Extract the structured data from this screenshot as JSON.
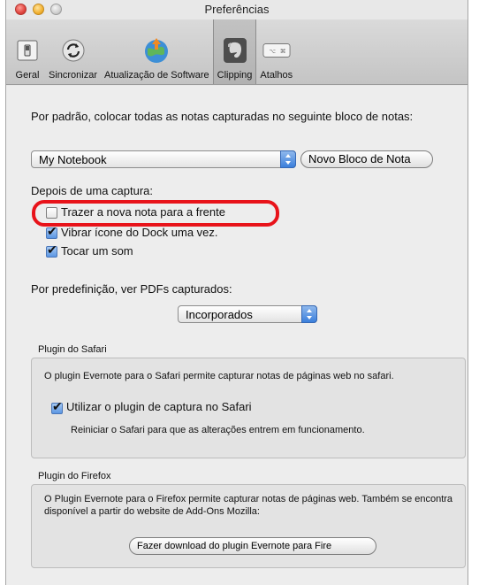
{
  "window": {
    "title": "Preferências"
  },
  "toolbar": {
    "items": [
      {
        "label": "Geral",
        "icon": "general-switch-icon"
      },
      {
        "label": "Sincronizar",
        "icon": "sync-icon"
      },
      {
        "label": "Atualização de Software",
        "icon": "software-update-globe-icon"
      },
      {
        "label": "Clipping",
        "icon": "evernote-elephant-icon",
        "selected": true
      },
      {
        "label": "Atalhos",
        "icon": "keyboard-shortcut-icon"
      }
    ]
  },
  "notebook": {
    "prompt": "Por padrão, colocar todas as notas capturadas no seguinte bloco de notas:",
    "selected": "My Notebook",
    "new_button": "Novo Bloco de Nota"
  },
  "after_capture": {
    "heading": "Depois de uma captura:",
    "options": [
      {
        "label": "Trazer a nova nota para a frente",
        "checked": false
      },
      {
        "label": "Vibrar ícone do Dock uma vez.",
        "checked": true
      },
      {
        "label": "Tocar um som",
        "checked": true
      }
    ]
  },
  "pdf": {
    "prompt": "Por predefinição, ver PDFs capturados:",
    "selected": "Incorporados"
  },
  "safari": {
    "title": "Plugin do Safari",
    "description": "O plugin Evernote para o Safari permite capturar notas de páginas web no safari.",
    "checkbox_label": "Utilizar o plugin de captura no Safari",
    "checked": true,
    "note": "Reiniciar o Safari para que as alterações entrem em funcionamento."
  },
  "firefox": {
    "title": "Plugin do Firefox",
    "description": "O Plugin Evernote para o Firefox permite capturar notas de páginas web. Também se encontra disponível a partir do website de Add-Ons Mozilla:",
    "download_button": "Fazer download do plugin Evernote para Fire"
  },
  "colors": {
    "highlight": "#e8131a",
    "accent": "#3b7fdc"
  }
}
